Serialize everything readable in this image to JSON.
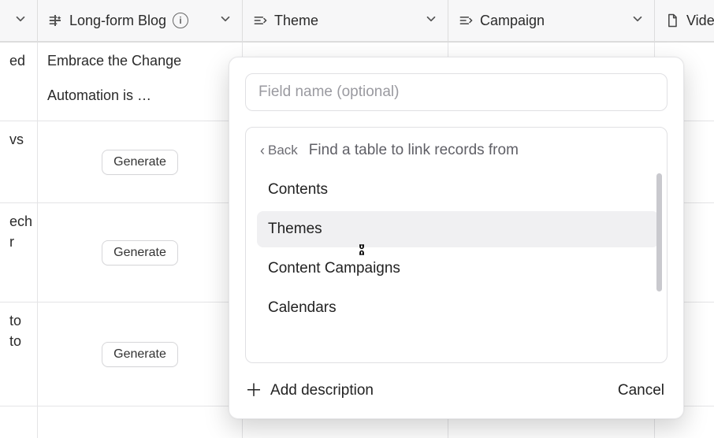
{
  "columns": {
    "blog": {
      "label": "Long-form Blog"
    },
    "theme": {
      "label": "Theme"
    },
    "campaign": {
      "label": "Campaign"
    },
    "video": {
      "label": "Vide"
    }
  },
  "rows": [
    {
      "col0": "ed",
      "blog_line1": "Embrace the Change",
      "blog_line2": "Automation is …"
    },
    {
      "col0": "vs",
      "button": "Generate"
    },
    {
      "col0_line1": "ech",
      "col0_line2": "r",
      "button": "Generate"
    },
    {
      "col0_line1": "to",
      "col0_line2": "to",
      "button": "Generate"
    }
  ],
  "popover": {
    "placeholder": "Field name (optional)",
    "back_label": "Back",
    "prompt": "Find a table to link records from",
    "options": [
      "Contents",
      "Themes",
      "Content Campaigns",
      "Calendars"
    ],
    "hover_index": 1,
    "add_description": "Add description",
    "cancel": "Cancel"
  }
}
